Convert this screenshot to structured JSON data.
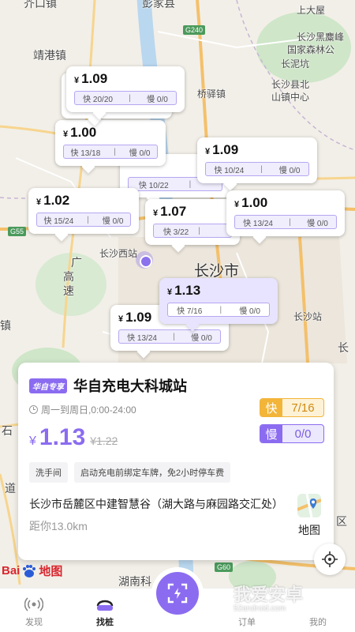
{
  "map": {
    "labels": {
      "jieshi": "芥口镇",
      "pengjiaxian": "彭家县",
      "shangdawu": "上大屋",
      "jinggang": "靖港镇",
      "heimuleng_1": "长沙黑麋峰",
      "heimuleng_2": "国家森林公",
      "changshaxian_border": "长泥坑",
      "qiaoyi": "桥驿镇",
      "changshaxian_bei_1": "长沙县北",
      "changshaxian_bei_2": "山镇中心",
      "guangao_1": "广",
      "guangao_2": "高",
      "guangao_3": "速",
      "changsha_west": "长沙西站",
      "changsha_city": "长沙市",
      "changsha_station": "长沙站",
      "chang_right": "长",
      "zhen_left": "镇",
      "shi_left": "石",
      "dao_left": "道",
      "qu_right": "区",
      "hunanke": "湖南科"
    },
    "road_badges": [
      "G240",
      "G55",
      "G60"
    ]
  },
  "price_cards": [
    {
      "price": "1.09",
      "fast": "快 20/20",
      "slow": "慢 0/0"
    },
    {
      "price": "1.00",
      "fast": "快 13/18",
      "slow": "慢 0/0"
    },
    {
      "price": "1.09",
      "fast": "快 10/24",
      "slow": "慢 0/0"
    },
    {
      "price": "",
      "fast": "快 10/22",
      "slow": ""
    },
    {
      "price": "1.02",
      "fast": "快 15/24",
      "slow": "慢 0/0"
    },
    {
      "price": "1.07",
      "fast": "快 3/22",
      "slow": ""
    },
    {
      "price": "1.00",
      "fast": "快 13/24",
      "slow": "慢 0/0"
    },
    {
      "price": "1.13",
      "fast": "快 7/16",
      "slow": "慢 0/0"
    },
    {
      "price": "1.09",
      "fast": "快 13/24",
      "slow": "慢 0/0"
    }
  ],
  "currency": "¥",
  "separator": "|",
  "station": {
    "brand_tag": "华自专享",
    "name": "华自充电大科城站",
    "hours": "周一到周日,0:00-24:00",
    "currency": "¥",
    "price": "1.13",
    "old_price": "¥1.22",
    "fast_label": "快",
    "fast_count": "7/16",
    "slow_label": "慢",
    "slow_count": "0/0",
    "tags": [
      "洗手间",
      "启动充电前绑定车牌，免2小时停车费"
    ],
    "address": "长沙市岳麓区中建智慧谷（湖大路与麻园路交汇处）",
    "distance": "距你13.0km",
    "map_button": "地图"
  },
  "baidu_logo": "地图",
  "baidu_prefix": "Bai",
  "watermark": {
    "main": "我爱安卓",
    "sub": "52android.com"
  },
  "tabbar": {
    "discover": "发现",
    "find_pile": "找桩",
    "orders": "订单",
    "mine": "我的"
  },
  "colors": {
    "accent": "#8b6cf0",
    "fast": "#f2b53a",
    "map_bg": "#f2efe8"
  }
}
